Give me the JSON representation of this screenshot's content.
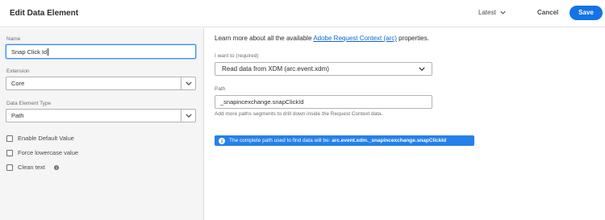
{
  "header": {
    "title": "Edit Data Element",
    "version": "Latest",
    "cancel_label": "Cancel",
    "save_label": "Save"
  },
  "sidebar": {
    "name_label": "Name",
    "name_value": "Snap Click Id",
    "extension_label": "Extension",
    "extension_value": "Core",
    "type_label": "Data Element Type",
    "type_value": "Path",
    "checkboxes": [
      {
        "label": "Enable Default Value",
        "checked": false
      },
      {
        "label": "Force lowercase value",
        "checked": false
      },
      {
        "label": "Clean text",
        "checked": false
      }
    ]
  },
  "main": {
    "intro_prefix": "Learn more about all the available ",
    "intro_link": "Adobe Request Context (arc)",
    "intro_suffix": " properties.",
    "want_label": "I want to (required)",
    "want_value": "Read data from XDM (arc.event.xdm)",
    "path_label": "Path",
    "path_value": "_snapincexchange.snapClickId",
    "path_help": "Add more paths segments to drill down inside the Request Context data.",
    "banner_text": "The complete path used to find data will be: ",
    "banner_path": "arc.event.xdm._snapincexchange.snapClickId"
  },
  "colors": {
    "accent": "#1473e6",
    "banner": "#2680eb",
    "link": "#0d66d0",
    "sidebar_bg": "#f5f5f5"
  },
  "icons": [
    "chevron-down-icon",
    "info-icon"
  ]
}
